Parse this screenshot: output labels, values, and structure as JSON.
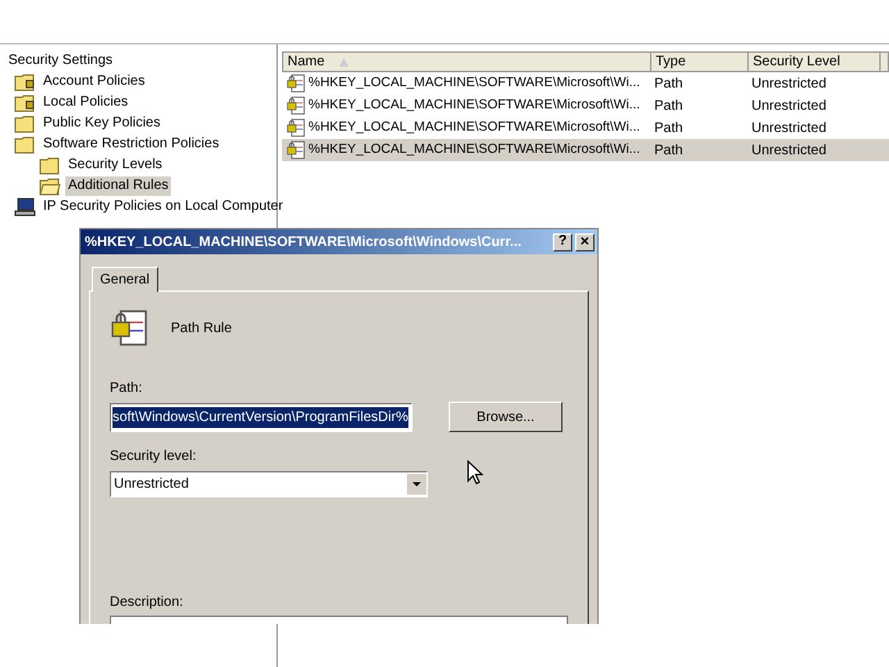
{
  "tree": [
    {
      "label": "Security Settings",
      "selected": false,
      "children": [
        {
          "label": "Account Policies",
          "kind": "locked-folder",
          "selected": false
        },
        {
          "label": "Local Policies",
          "kind": "locked-folder",
          "selected": false
        },
        {
          "label": "Public Key Policies",
          "kind": "folder",
          "selected": false
        },
        {
          "label": "Software Restriction Policies",
          "kind": "folder",
          "selected": false,
          "children": [
            {
              "label": "Security Levels",
              "kind": "folder",
              "selected": false
            },
            {
              "label": "Additional Rules",
              "kind": "open-folder",
              "selected": true
            }
          ]
        },
        {
          "label": "IP Security Policies on Local Computer",
          "kind": "computer",
          "selected": false
        }
      ]
    }
  ],
  "list": {
    "columns": [
      "Name",
      "Type",
      "Security Level"
    ],
    "rows": [
      {
        "name": "%HKEY_LOCAL_MACHINE\\SOFTWARE\\Microsoft\\Wi...",
        "type": "Path",
        "security_level": "Unrestricted",
        "selected": false
      },
      {
        "name": "%HKEY_LOCAL_MACHINE\\SOFTWARE\\Microsoft\\Wi...",
        "type": "Path",
        "security_level": "Unrestricted",
        "selected": false
      },
      {
        "name": "%HKEY_LOCAL_MACHINE\\SOFTWARE\\Microsoft\\Wi...",
        "type": "Path",
        "security_level": "Unrestricted",
        "selected": false
      },
      {
        "name": "%HKEY_LOCAL_MACHINE\\SOFTWARE\\Microsoft\\Wi...",
        "type": "Path",
        "security_level": "Unrestricted",
        "selected": true
      }
    ]
  },
  "dialog": {
    "title": "%HKEY_LOCAL_MACHINE\\SOFTWARE\\Microsoft\\Windows\\Curr...",
    "help_button": "?",
    "close_button": "×",
    "tabs": [
      {
        "label": "General",
        "selected": true
      }
    ],
    "rule_type": "Path Rule",
    "path_label": "Path:",
    "path_value": "soft\\Windows\\CurrentVersion\\ProgramFilesDir%",
    "browse_button": "Browse...",
    "security_level_label": "Security level:",
    "security_level_value": "Unrestricted",
    "description_label": "Description:"
  }
}
